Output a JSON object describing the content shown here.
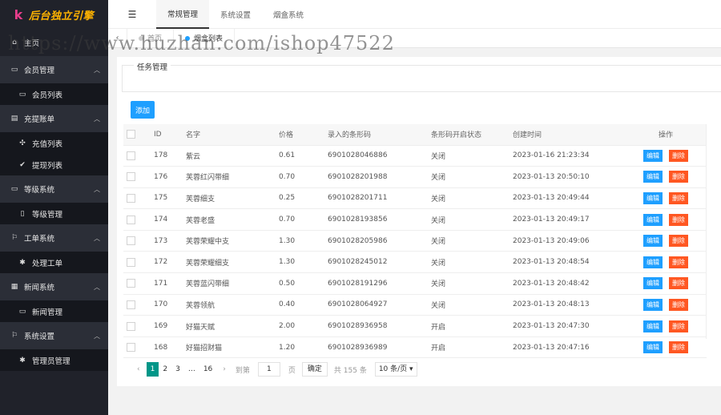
{
  "logo": {
    "mark": "k",
    "text": "后台独立引擎"
  },
  "topbar": {
    "menu_icon": "☰",
    "tabs": [
      "常规管理",
      "系统设置",
      "烟盒系统"
    ]
  },
  "tabbar": {
    "prev": "‹",
    "home_tab": "首页",
    "active_tab": "烟盒列表"
  },
  "watermark": "https://www.huzhan.com/ishop47522",
  "sidebar": {
    "home": "主页",
    "groups": [
      {
        "label": "会员管理",
        "items": [
          "会员列表"
        ]
      },
      {
        "label": "充提账单",
        "items": [
          "充值列表",
          "提现列表"
        ]
      },
      {
        "label": "等级系统",
        "items": [
          "等级管理"
        ]
      },
      {
        "label": "工单系统",
        "items": [
          "处理工单"
        ]
      },
      {
        "label": "新闻系统",
        "items": [
          "新闻管理"
        ]
      },
      {
        "label": "系统设置",
        "items": [
          "管理员管理"
        ]
      }
    ]
  },
  "main": {
    "fieldset_legend": "任务管理",
    "add_button": "添加",
    "columns": [
      "ID",
      "名字",
      "价格",
      "录入的条形码",
      "条形码开启状态",
      "创建时间",
      "操作"
    ],
    "edit_label": "编辑",
    "delete_label": "删除",
    "rows": [
      [
        "178",
        "紫云",
        "0.61",
        "6901028046886",
        "关闭",
        "2023-01-16 21:23:34"
      ],
      [
        "176",
        "芙蓉红闪带细",
        "0.70",
        "6901028201988",
        "关闭",
        "2023-01-13 20:50:10"
      ],
      [
        "175",
        "芙蓉细支",
        "0.25",
        "6901028201711",
        "关闭",
        "2023-01-13 20:49:44"
      ],
      [
        "174",
        "芙蓉老盛",
        "0.70",
        "6901028193856",
        "关闭",
        "2023-01-13 20:49:17"
      ],
      [
        "173",
        "芙蓉荣耀中支",
        "1.30",
        "6901028205986",
        "关闭",
        "2023-01-13 20:49:06"
      ],
      [
        "172",
        "芙蓉荣耀细支",
        "1.30",
        "6901028245012",
        "关闭",
        "2023-01-13 20:48:54"
      ],
      [
        "171",
        "芙蓉蓝闪带细",
        "0.50",
        "6901028191296",
        "关闭",
        "2023-01-13 20:48:42"
      ],
      [
        "170",
        "芙蓉领航",
        "0.40",
        "6901028064927",
        "关闭",
        "2023-01-13 20:48:13"
      ],
      [
        "169",
        "好猫天赋",
        "2.00",
        "6901028936958",
        "开启",
        "2023-01-13 20:47:30"
      ],
      [
        "168",
        "好猫招财猫",
        "1.20",
        "6901028936989",
        "开启",
        "2023-01-13 20:47:16"
      ]
    ]
  },
  "pager": {
    "prev": "‹",
    "pages": [
      "1",
      "2",
      "3",
      "…",
      "16"
    ],
    "next": "›",
    "goto_label": "到第",
    "goto_value": "1",
    "page_unit": "页",
    "confirm": "确定",
    "total": "共 155 条",
    "page_size": "10 条/页 ▾"
  }
}
